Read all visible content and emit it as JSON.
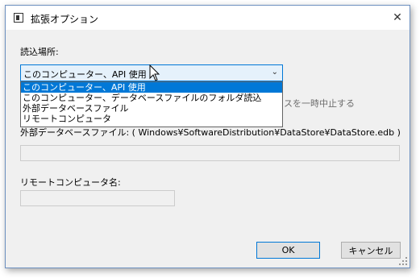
{
  "window": {
    "title": "拡張オプション",
    "close_glyph": "✕"
  },
  "labels": {
    "read_location": "読込場所:",
    "external_file": "外部データベースファイル: ( Windows¥SoftwareDistribution¥DataStore¥DataStore.edb )",
    "remote_computer": "リモートコンピュータ名:",
    "obscured_checkbox_text": "スを一時中止する"
  },
  "combo": {
    "selected_value": "このコンピューター、API 使用",
    "arrow_glyph": "⌄",
    "options": [
      "このコンピューター、API 使用",
      "このコンピューター、データベースファイルのフォルダ読込",
      "外部データベースファイル",
      "リモートコンピュータ"
    ]
  },
  "buttons": {
    "ok": "OK",
    "cancel": "キャンセル"
  },
  "icons": {
    "app": "window-app-icon",
    "close": "close-icon",
    "cursor": "mouse-pointer-icon",
    "grip": "resize-grip-icon"
  },
  "colors": {
    "accent": "#0078d7",
    "combo_bg": "#e5f1fb",
    "dialog_bg": "#f0f0f0"
  }
}
